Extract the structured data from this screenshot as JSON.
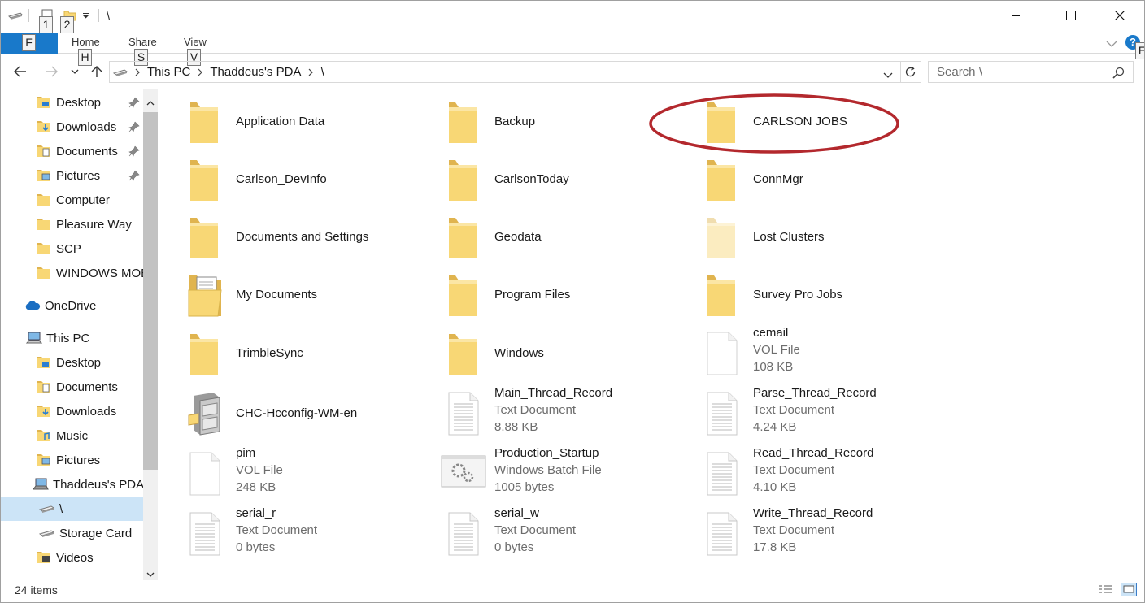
{
  "titlebar": {
    "title": "\\",
    "keytips": [
      "1",
      "2"
    ],
    "minimize_label": "Minimize",
    "maximize_label": "Maximize",
    "close_label": "Close"
  },
  "ribbon": {
    "file_key": "F",
    "tabs": [
      {
        "label": "Home",
        "key": "H"
      },
      {
        "label": "Share",
        "key": "S"
      },
      {
        "label": "View",
        "key": "V"
      }
    ],
    "help_key": "E"
  },
  "address": {
    "crumbs": [
      "This PC",
      "Thaddeus's PDA",
      "\\"
    ],
    "search_placeholder": "Search \\"
  },
  "nav": {
    "items": [
      {
        "label": "Desktop",
        "icon": "desktop-folder-icon",
        "pinned": true
      },
      {
        "label": "Downloads",
        "icon": "downloads-folder-icon",
        "pinned": true
      },
      {
        "label": "Documents",
        "icon": "documents-folder-icon",
        "pinned": true
      },
      {
        "label": "Pictures",
        "icon": "pictures-folder-icon",
        "pinned": true
      },
      {
        "label": "Computer",
        "icon": "folder-icon",
        "pinned": false
      },
      {
        "label": "Pleasure Way",
        "icon": "folder-icon",
        "pinned": false
      },
      {
        "label": "SCP",
        "icon": "folder-icon",
        "pinned": false
      },
      {
        "label": "WINDOWS MOB",
        "icon": "folder-icon",
        "pinned": false
      },
      {
        "label": "OneDrive",
        "icon": "onedrive-icon",
        "pinned": false
      },
      {
        "label": "This PC",
        "icon": "this-pc-icon",
        "pinned": false
      },
      {
        "label": "Desktop",
        "icon": "desktop-folder-icon",
        "pinned": false
      },
      {
        "label": "Documents",
        "icon": "documents-folder-icon",
        "pinned": false
      },
      {
        "label": "Downloads",
        "icon": "downloads-folder-icon",
        "pinned": false
      },
      {
        "label": "Music",
        "icon": "music-folder-icon",
        "pinned": false
      },
      {
        "label": "Pictures",
        "icon": "pictures-folder-icon",
        "pinned": false
      },
      {
        "label": "Thaddeus's PDA",
        "icon": "pda-device-icon",
        "pinned": false
      },
      {
        "label": "\\",
        "icon": "drive-icon",
        "pinned": false,
        "selected": true
      },
      {
        "label": "Storage Card",
        "icon": "drive-icon",
        "pinned": false
      },
      {
        "label": "Videos",
        "icon": "videos-folder-icon",
        "pinned": false
      }
    ]
  },
  "items": [
    {
      "name": "Application Data",
      "type": "",
      "size": "",
      "icon": "folder-icon"
    },
    {
      "name": "Backup",
      "type": "",
      "size": "",
      "icon": "folder-icon"
    },
    {
      "name": "CARLSON JOBS",
      "type": "",
      "size": "",
      "icon": "folder-icon",
      "circled": true
    },
    {
      "name": "Carlson_DevInfo",
      "type": "",
      "size": "",
      "icon": "folder-icon"
    },
    {
      "name": "CarlsonToday",
      "type": "",
      "size": "",
      "icon": "folder-icon"
    },
    {
      "name": "ConnMgr",
      "type": "",
      "size": "",
      "icon": "folder-icon"
    },
    {
      "name": "Documents and Settings",
      "type": "",
      "size": "",
      "icon": "folder-icon"
    },
    {
      "name": "Geodata",
      "type": "",
      "size": "",
      "icon": "folder-icon"
    },
    {
      "name": "Lost Clusters",
      "type": "",
      "size": "",
      "icon": "hidden-folder-icon"
    },
    {
      "name": "My Documents",
      "type": "",
      "size": "",
      "icon": "documents-folder-icon"
    },
    {
      "name": "Program Files",
      "type": "",
      "size": "",
      "icon": "folder-icon"
    },
    {
      "name": "Survey Pro Jobs",
      "type": "",
      "size": "",
      "icon": "folder-icon"
    },
    {
      "name": "TrimbleSync",
      "type": "",
      "size": "",
      "icon": "folder-icon"
    },
    {
      "name": "Windows",
      "type": "",
      "size": "",
      "icon": "folder-icon"
    },
    {
      "name": "cemail",
      "type": "VOL File",
      "size": "108 KB",
      "icon": "blank-file-icon"
    },
    {
      "name": "CHC-Hcconfig-WM-en",
      "type": "",
      "size": "",
      "icon": "file-cabinet-icon"
    },
    {
      "name": "Main_Thread_Record",
      "type": "Text Document",
      "size": "8.88 KB",
      "icon": "text-file-icon"
    },
    {
      "name": "Parse_Thread_Record",
      "type": "Text Document",
      "size": "4.24 KB",
      "icon": "text-file-icon"
    },
    {
      "name": "pim",
      "type": "VOL File",
      "size": "248 KB",
      "icon": "blank-file-icon"
    },
    {
      "name": "Production_Startup",
      "type": "Windows Batch File",
      "size": "1005 bytes",
      "icon": "batch-file-icon"
    },
    {
      "name": "Read_Thread_Record",
      "type": "Text Document",
      "size": "4.10 KB",
      "icon": "text-file-icon"
    },
    {
      "name": "serial_r",
      "type": "Text Document",
      "size": "0 bytes",
      "icon": "text-file-icon"
    },
    {
      "name": "serial_w",
      "type": "Text Document",
      "size": "0 bytes",
      "icon": "text-file-icon"
    },
    {
      "name": "Write_Thread_Record",
      "type": "Text Document",
      "size": "17.8 KB",
      "icon": "text-file-icon"
    }
  ],
  "status": {
    "count": "24 items"
  },
  "colors": {
    "accent": "#1979ca",
    "selection": "#cce4f7",
    "folder": "#f8d775",
    "annotation_circle": "#b3282d"
  }
}
